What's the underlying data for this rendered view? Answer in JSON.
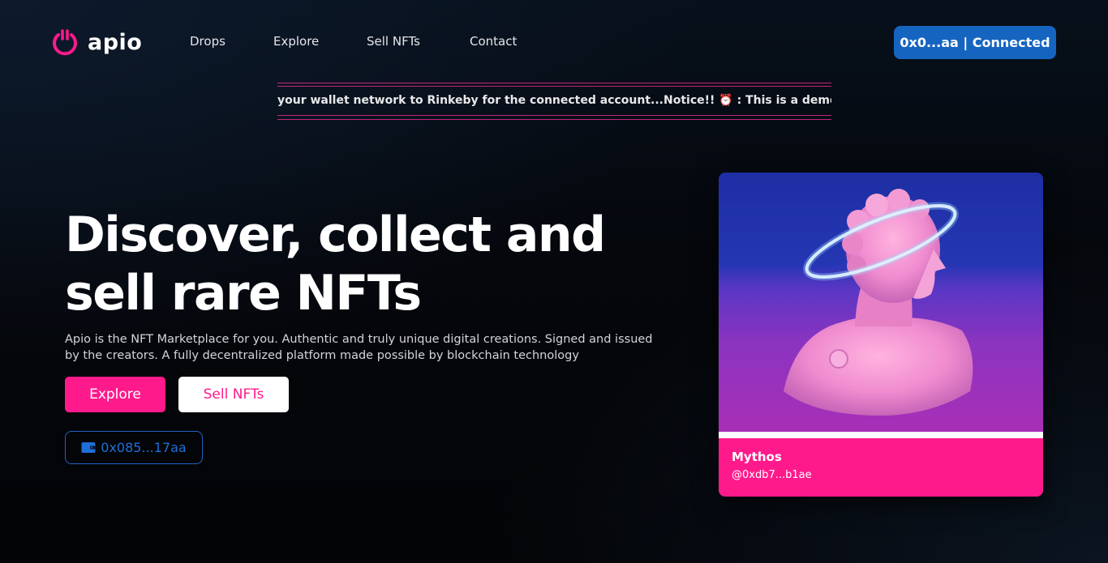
{
  "brand": {
    "name": "apio",
    "logo_icon": "power-icon",
    "accent": "#ff1a8c"
  },
  "nav": {
    "items": [
      {
        "label": "Drops"
      },
      {
        "label": "Explore"
      },
      {
        "label": "Sell NFTs"
      },
      {
        "label": "Contact"
      }
    ]
  },
  "wallet_button": {
    "label": "0x0...aa | Connected",
    "color": "#1565c0"
  },
  "ticker": {
    "text_before": "your wallet network to Rinkeby for the connected account...Notice!! ",
    "alarm_icon": "⏰",
    "text_after": " : This is a demo proje"
  },
  "hero": {
    "title_line1": "Discover, collect and",
    "title_line2": "sell rare NFTs",
    "description": "Apio is the NFT Marketplace for you. Authentic and truly unique digital creations. Signed and issued by the creators. A fully decentralized platform made possible by blockchain technology",
    "explore_label": "Explore",
    "sell_label": "Sell NFTs",
    "wallet_address": "0x085...17aa",
    "wallet_icon": "wallet-icon"
  },
  "featured_nft": {
    "title": "Mythos",
    "owner": "@0xdb7...b1ae",
    "image_subject": "pink marble bust with glowing halo"
  }
}
